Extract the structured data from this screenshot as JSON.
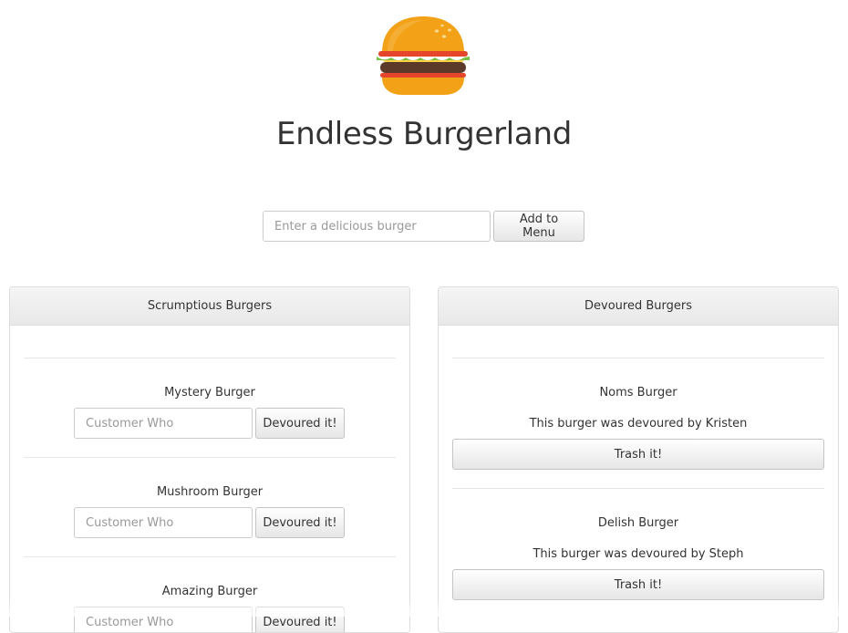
{
  "header": {
    "logo_icon": "hamburger-icon",
    "title": "Endless Burgerland"
  },
  "add_form": {
    "placeholder": "Enter a delicious burger",
    "value": "",
    "button_label": "Add to Menu"
  },
  "scrumptious": {
    "heading": "Scrumptious Burgers",
    "items": [
      {
        "name": "Mystery Burger",
        "placeholder": "Customer Who",
        "button_label": "Devoured it!"
      },
      {
        "name": "Mushroom Burger",
        "placeholder": "Customer Who",
        "button_label": "Devoured it!"
      },
      {
        "name": "Amazing Burger",
        "placeholder": "Customer Who",
        "button_label": "Devoured it!"
      }
    ]
  },
  "devoured": {
    "heading": "Devoured Burgers",
    "items": [
      {
        "name": "Noms Burger",
        "devoured_text": "This burger was devoured by Kristen",
        "button_label": "Trash it!"
      },
      {
        "name": "Delish Burger",
        "devoured_text": "This burger was devoured by Steph",
        "button_label": "Trash it!"
      }
    ]
  },
  "colors": {
    "bun": "#f3a116",
    "lettuce": "#7ac143",
    "patty": "#5b3a29",
    "tomato": "#e4452b",
    "panel_border": "#dddddd"
  }
}
